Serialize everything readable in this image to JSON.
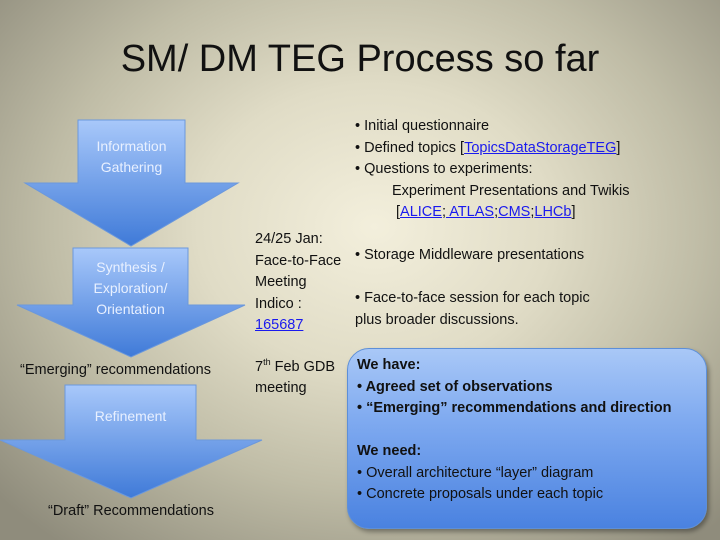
{
  "title": "SM/ DM TEG Process so far",
  "process": {
    "colors": {
      "arrow_top": "#a8c8fa",
      "arrow_bottom": "#3f7ad8",
      "label_text": "#e8f0ff"
    },
    "steps": [
      {
        "label_line1": "Information",
        "label_line2": "Gathering"
      },
      {
        "label_line1": "Synthesis /",
        "label_line2": "Exploration/",
        "label_line3": "Orientation"
      },
      {
        "label_line1": "Refinement"
      }
    ],
    "outcomes": {
      "emerging": "“Emerging” recommendations",
      "draft": "“Draft” Recommendations"
    }
  },
  "meeting": {
    "date": "24/25 Jan:",
    "line2": "Face-to-Face",
    "line3": "Meeting",
    "indico_label": "Indico :",
    "indico_link": "165687"
  },
  "gdb": {
    "day": "7",
    "day_suffix": "th",
    "rest": " Feb GDB",
    "line2": "meeting"
  },
  "info_gathering": {
    "bullet1": "Initial questionnaire",
    "bullet2_prefix": "Defined topics [",
    "bullet2_link": "TopicsDataStorageTEG",
    "bullet2_suffix": "]",
    "bullet3": "Questions to experiments:",
    "sub_line": "Experiment Presentations and Twikis",
    "experiments": [
      "ALICE",
      " ATLAS",
      "CMS",
      "LHCb"
    ]
  },
  "f2f": {
    "bullet1": "Storage Middleware presentations",
    "bullet2_line1": "Face-to-face session for each topic",
    "bullet2_line2": "plus broader discussions."
  },
  "status_box": {
    "have_heading": "We have:",
    "have_items": [
      "Agreed set of observations",
      "“Emerging” recommendations and direction"
    ],
    "need_heading": "We need:",
    "need_items": [
      "Overall architecture “layer” diagram",
      "Concrete proposals under each topic"
    ]
  },
  "bullet": "•"
}
